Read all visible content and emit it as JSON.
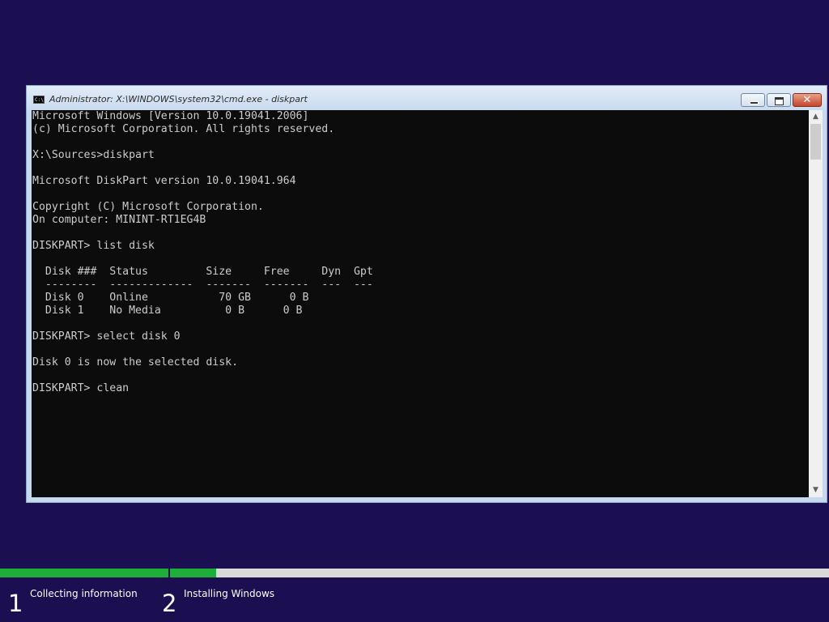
{
  "window": {
    "title": "Administrator: X:\\WINDOWS\\system32\\cmd.exe - diskpart",
    "icon": "cmd-console-icon",
    "controls": {
      "minimize": "minimize-icon",
      "maximize": "maximize-icon",
      "close": "close-icon",
      "close_glyph": "✕"
    }
  },
  "console": {
    "lines": [
      "Microsoft Windows [Version 10.0.19041.2006]",
      "(c) Microsoft Corporation. All rights reserved.",
      "",
      "X:\\Sources>diskpart",
      "",
      "Microsoft DiskPart version 10.0.19041.964",
      "",
      "Copyright (C) Microsoft Corporation.",
      "On computer: MININT-RT1EG4B",
      "",
      "DISKPART> list disk",
      "",
      "  Disk ###  Status         Size     Free     Dyn  Gpt",
      "  --------  -------------  -------  -------  ---  ---",
      "  Disk 0    Online           70 GB      0 B",
      "  Disk 1    No Media          0 B      0 B",
      "",
      "DISKPART> select disk 0",
      "",
      "Disk 0 is now the selected disk.",
      "",
      "DISKPART> clean"
    ]
  },
  "setup": {
    "steps": [
      {
        "number": "1",
        "label": "Collecting information",
        "progress": 1.0
      },
      {
        "number": "2",
        "label": "Installing Windows",
        "progress": 0.07
      }
    ],
    "colors": {
      "background": "#1b0f52",
      "progress_fill": "#1fae3a",
      "progress_track": "#d9d9d9"
    }
  }
}
